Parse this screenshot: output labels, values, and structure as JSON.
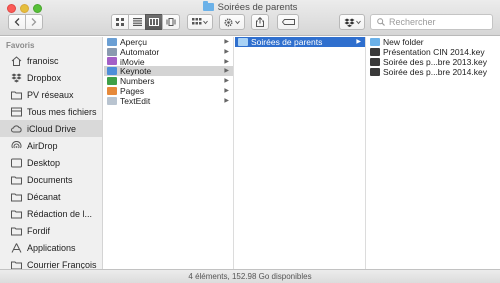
{
  "window": {
    "title": "Soirées de parents"
  },
  "toolbar": {
    "search_placeholder": "Rechercher"
  },
  "sidebar": {
    "header": "Favoris",
    "items": [
      {
        "label": "franoisc",
        "icon": "home-icon"
      },
      {
        "label": "Dropbox",
        "icon": "dropbox-icon"
      },
      {
        "label": "PV réseaux",
        "icon": "folder-icon"
      },
      {
        "label": "Tous mes fichiers",
        "icon": "all-files-icon"
      },
      {
        "label": "iCloud Drive",
        "icon": "cloud-icon",
        "selected": true
      },
      {
        "label": "AirDrop",
        "icon": "airdrop-icon"
      },
      {
        "label": "Desktop",
        "icon": "desktop-icon"
      },
      {
        "label": "Documents",
        "icon": "documents-icon"
      },
      {
        "label": "Décanat",
        "icon": "folder-icon"
      },
      {
        "label": "Rédaction de l...",
        "icon": "folder-icon"
      },
      {
        "label": "Fordif",
        "icon": "folder-icon"
      },
      {
        "label": "Applications",
        "icon": "applications-icon"
      },
      {
        "label": "Courrier François",
        "icon": "folder-icon"
      }
    ]
  },
  "column1": {
    "items": [
      {
        "label": "Aperçu",
        "color": "#6b9fd4"
      },
      {
        "label": "Automator",
        "color": "#8a9ab0"
      },
      {
        "label": "iMovie",
        "color": "#a35fc7"
      },
      {
        "label": "Keynote",
        "color": "#4d8ed9",
        "selected": true
      },
      {
        "label": "Numbers",
        "color": "#3fa047"
      },
      {
        "label": "Pages",
        "color": "#e6893a"
      },
      {
        "label": "TextEdit",
        "color": "#b9c4d0"
      }
    ]
  },
  "column2": {
    "items": [
      {
        "label": "Soirées de parents",
        "selected": true
      }
    ]
  },
  "column3": {
    "items": [
      {
        "label": "New folder",
        "kind": "folder"
      },
      {
        "label": "Présentation CIN 2014.key",
        "kind": "file"
      },
      {
        "label": "Soirée des p...bre 2013.key",
        "kind": "file"
      },
      {
        "label": "Soirée des p...bre 2014.key",
        "kind": "file"
      }
    ]
  },
  "status": {
    "text": "4 éléments, 152.98 Go disponibles"
  },
  "colors": {
    "selection_blue": "#2f6fce",
    "folder_blue": "#6bb1e8"
  }
}
